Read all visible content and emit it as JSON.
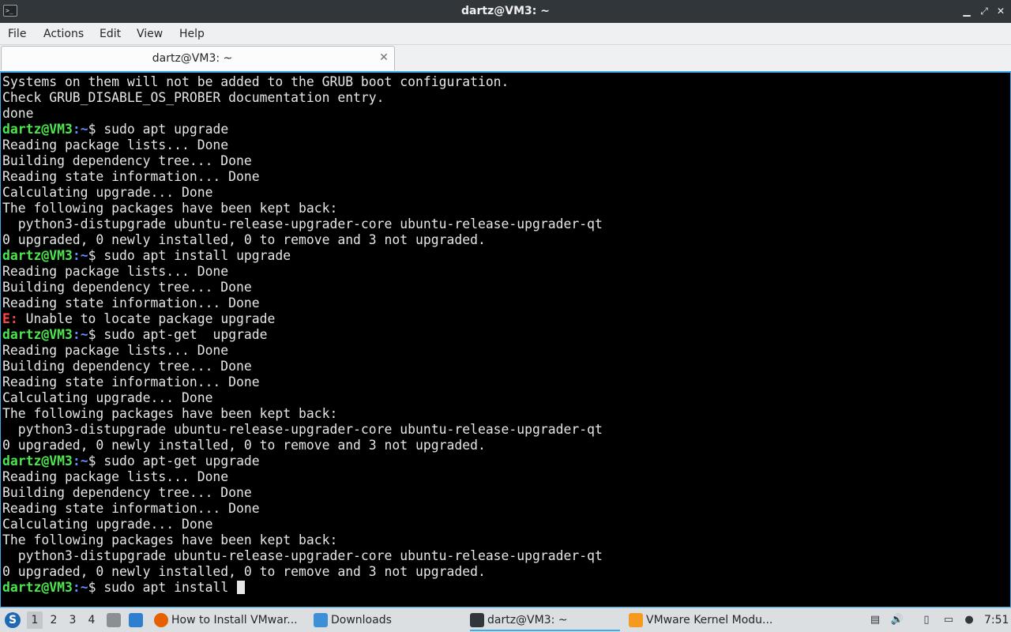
{
  "window": {
    "title": "dartz@VM3: ~",
    "app_icon_glyph": ">_",
    "minimize_glyph": "▁",
    "restore_glyph": "⤢",
    "close_glyph": "✕"
  },
  "menu": {
    "items": [
      "File",
      "Actions",
      "Edit",
      "View",
      "Help"
    ]
  },
  "tabs": [
    {
      "label": "dartz@VM3: ~",
      "close_glyph": "✕"
    }
  ],
  "terminal": {
    "colors": {
      "prompt_user": "#4fe54f",
      "prompt_path": "#5b8ff9",
      "error": "#ff4646",
      "text": "#e6e6e6",
      "background": "#000000"
    },
    "lines": [
      {
        "type": "out",
        "text": "Systems on them will not be added to the GRUB boot configuration."
      },
      {
        "type": "out",
        "text": "Check GRUB_DISABLE_OS_PROBER documentation entry."
      },
      {
        "type": "out",
        "text": "done"
      },
      {
        "type": "prompt",
        "user": "dartz@VM3",
        "path": "~",
        "cmd": "sudo apt upgrade"
      },
      {
        "type": "out",
        "text": "Reading package lists... Done"
      },
      {
        "type": "out",
        "text": "Building dependency tree... Done"
      },
      {
        "type": "out",
        "text": "Reading state information... Done"
      },
      {
        "type": "out",
        "text": "Calculating upgrade... Done"
      },
      {
        "type": "out",
        "text": "The following packages have been kept back:"
      },
      {
        "type": "out",
        "text": "  python3-distupgrade ubuntu-release-upgrader-core ubuntu-release-upgrader-qt"
      },
      {
        "type": "out",
        "text": "0 upgraded, 0 newly installed, 0 to remove and 3 not upgraded."
      },
      {
        "type": "prompt",
        "user": "dartz@VM3",
        "path": "~",
        "cmd": "sudo apt install upgrade"
      },
      {
        "type": "out",
        "text": "Reading package lists... Done"
      },
      {
        "type": "out",
        "text": "Building dependency tree... Done"
      },
      {
        "type": "out",
        "text": "Reading state information... Done"
      },
      {
        "type": "err",
        "tag": "E:",
        "text": " Unable to locate package upgrade"
      },
      {
        "type": "prompt",
        "user": "dartz@VM3",
        "path": "~",
        "cmd": "sudo apt-get  upgrade"
      },
      {
        "type": "out",
        "text": "Reading package lists... Done"
      },
      {
        "type": "out",
        "text": "Building dependency tree... Done"
      },
      {
        "type": "out",
        "text": "Reading state information... Done"
      },
      {
        "type": "out",
        "text": "Calculating upgrade... Done"
      },
      {
        "type": "out",
        "text": "The following packages have been kept back:"
      },
      {
        "type": "out",
        "text": "  python3-distupgrade ubuntu-release-upgrader-core ubuntu-release-upgrader-qt"
      },
      {
        "type": "out",
        "text": "0 upgraded, 0 newly installed, 0 to remove and 3 not upgraded."
      },
      {
        "type": "prompt",
        "user": "dartz@VM3",
        "path": "~",
        "cmd": "sudo apt-get upgrade"
      },
      {
        "type": "out",
        "text": "Reading package lists... Done"
      },
      {
        "type": "out",
        "text": "Building dependency tree... Done"
      },
      {
        "type": "out",
        "text": "Reading state information... Done"
      },
      {
        "type": "out",
        "text": "Calculating upgrade... Done"
      },
      {
        "type": "out",
        "text": "The following packages have been kept back:"
      },
      {
        "type": "out",
        "text": "  python3-distupgrade ubuntu-release-upgrader-core ubuntu-release-upgrader-qt"
      },
      {
        "type": "out",
        "text": "0 upgraded, 0 newly installed, 0 to remove and 3 not upgraded."
      },
      {
        "type": "prompt",
        "user": "dartz@VM3",
        "path": "~",
        "cmd": "sudo apt install ",
        "cursor": true
      }
    ]
  },
  "taskbar": {
    "desktops": [
      "1",
      "2",
      "3",
      "4"
    ],
    "active_desktop": "1",
    "tasks": [
      {
        "label": "How to Install VMwar...",
        "icon": "firefox-icon",
        "color": "#e66000"
      },
      {
        "label": "Downloads",
        "icon": "folder-icon",
        "color": "#3d8fd6"
      },
      {
        "label": "dartz@VM3: ~",
        "icon": "terminal-icon",
        "color": "#31363b"
      },
      {
        "label": "VMware Kernel Modu...",
        "icon": "vmware-icon",
        "color": "#f39a1f"
      }
    ],
    "tray": [
      "clipboard-icon",
      "volume-icon",
      "files-icon",
      "network-icon",
      "notification-icon"
    ],
    "clock": "7:51"
  }
}
